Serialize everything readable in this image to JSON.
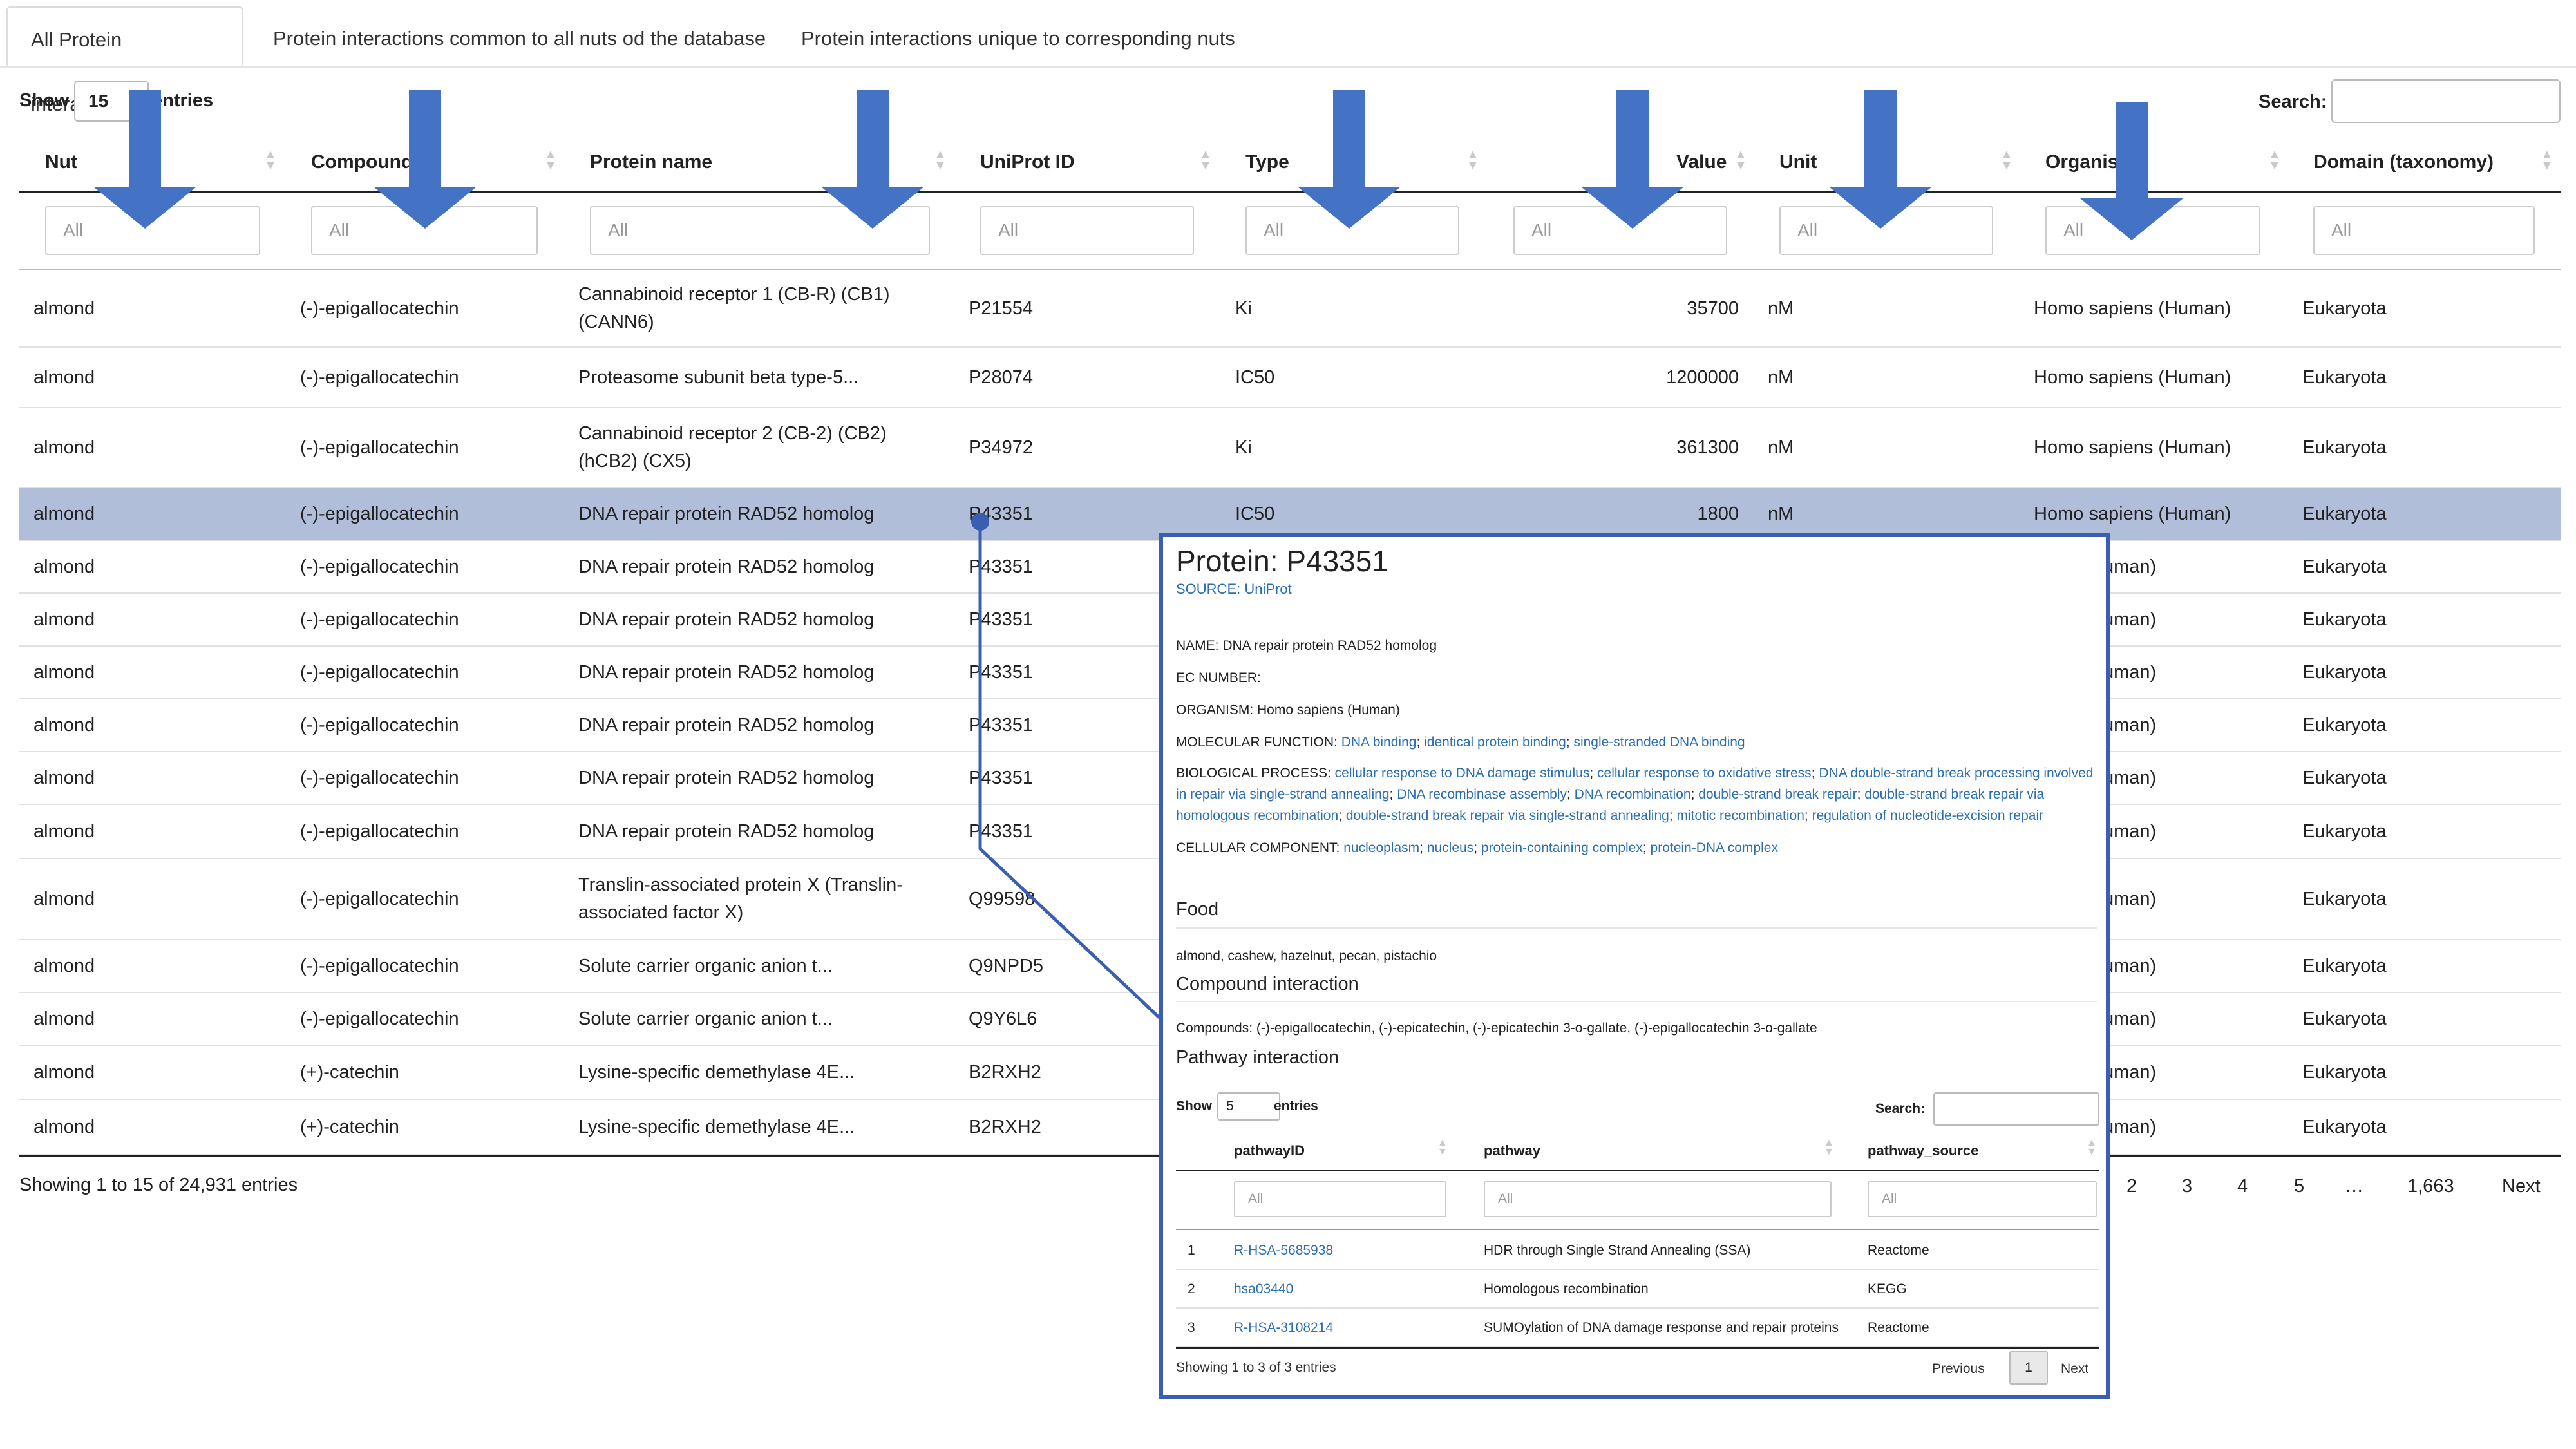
{
  "tabs": [
    {
      "label": "All Protein interactions",
      "active": true
    },
    {
      "label": "Protein interactions common to all nuts od the database",
      "active": false
    },
    {
      "label": "Protein interactions unique to corresponding nuts",
      "active": false
    }
  ],
  "length_control": {
    "show": "Show",
    "value": "15",
    "entries": "entries"
  },
  "search": {
    "label": "Search:",
    "value": ""
  },
  "columns": [
    "Nut",
    "Compound",
    "Protein name",
    "UniProt ID",
    "Type",
    "Value",
    "Unit",
    "Organism",
    "Domain (taxonomy)"
  ],
  "filter_placeholder": "All",
  "rows": [
    {
      "nut": "almond",
      "compound": "(-)-epigallocatechin",
      "protein": "Cannabinoid receptor 1 (CB-R) (CB1) (CANN6)",
      "uniprot": "P21554",
      "type": "Ki",
      "value": "35700",
      "unit": "nM",
      "organism": "Homo sapiens (Human)",
      "domain": "Eukaryota"
    },
    {
      "nut": "almond",
      "compound": "(-)-epigallocatechin",
      "protein": "Proteasome subunit beta type-5...",
      "uniprot": "P28074",
      "type": "IC50",
      "value": "1200000",
      "unit": "nM",
      "organism": "Homo sapiens (Human)",
      "domain": "Eukaryota"
    },
    {
      "nut": "almond",
      "compound": "(-)-epigallocatechin",
      "protein": "Cannabinoid receptor 2 (CB-2) (CB2) (hCB2) (CX5)",
      "uniprot": "P34972",
      "type": "Ki",
      "value": "361300",
      "unit": "nM",
      "organism": "Homo sapiens (Human)",
      "domain": "Eukaryota"
    },
    {
      "nut": "almond",
      "compound": "(-)-epigallocatechin",
      "protein": "DNA repair protein RAD52 homolog",
      "uniprot": "P43351",
      "type": "IC50",
      "value": "1800",
      "unit": "nM",
      "organism": "Homo sapiens (Human)",
      "domain": "Eukaryota"
    },
    {
      "nut": "almond",
      "compound": "(-)-epigallocatechin",
      "protein": "DNA repair protein RAD52 homolog",
      "uniprot": "P43351",
      "type": "",
      "value": "",
      "unit": "",
      "organism": "piens (Human)",
      "domain": "Eukaryota"
    },
    {
      "nut": "almond",
      "compound": "(-)-epigallocatechin",
      "protein": "DNA repair protein RAD52 homolog",
      "uniprot": "P43351",
      "type": "",
      "value": "",
      "unit": "",
      "organism": "piens (Human)",
      "domain": "Eukaryota"
    },
    {
      "nut": "almond",
      "compound": "(-)-epigallocatechin",
      "protein": "DNA repair protein RAD52 homolog",
      "uniprot": "P43351",
      "type": "",
      "value": "",
      "unit": "",
      "organism": "piens (Human)",
      "domain": "Eukaryota"
    },
    {
      "nut": "almond",
      "compound": "(-)-epigallocatechin",
      "protein": "DNA repair protein RAD52 homolog",
      "uniprot": "P43351",
      "type": "",
      "value": "",
      "unit": "",
      "organism": "piens (Human)",
      "domain": "Eukaryota"
    },
    {
      "nut": "almond",
      "compound": "(-)-epigallocatechin",
      "protein": "DNA repair protein RAD52 homolog",
      "uniprot": "P43351",
      "type": "",
      "value": "",
      "unit": "",
      "organism": "piens (Human)",
      "domain": "Eukaryota"
    },
    {
      "nut": "almond",
      "compound": "(-)-epigallocatechin",
      "protein": "DNA repair protein RAD52 homolog",
      "uniprot": "P43351",
      "type": "",
      "value": "",
      "unit": "",
      "organism": "piens (Human)",
      "domain": "Eukaryota"
    },
    {
      "nut": "almond",
      "compound": "(-)-epigallocatechin",
      "protein": "Translin-associated protein X (Translin-associated factor X)",
      "uniprot": "Q99598",
      "type": "",
      "value": "",
      "unit": "",
      "organism": "piens (Human)",
      "domain": "Eukaryota"
    },
    {
      "nut": "almond",
      "compound": "(-)-epigallocatechin",
      "protein": "Solute carrier organic anion t...",
      "uniprot": "Q9NPD5",
      "type": "",
      "value": "",
      "unit": "",
      "organism": "piens (Human)",
      "domain": "Eukaryota"
    },
    {
      "nut": "almond",
      "compound": "(-)-epigallocatechin",
      "protein": "Solute carrier organic anion t...",
      "uniprot": "Q9Y6L6",
      "type": "",
      "value": "",
      "unit": "",
      "organism": "piens (Human)",
      "domain": "Eukaryota"
    },
    {
      "nut": "almond",
      "compound": "(+)-catechin",
      "protein": "Lysine-specific demethylase 4E...",
      "uniprot": "B2RXH2",
      "type": "",
      "value": "",
      "unit": "",
      "organism": "piens (Human)",
      "domain": "Eukaryota"
    },
    {
      "nut": "almond",
      "compound": "(+)-catechin",
      "protein": "Lysine-specific demethylase 4E...",
      "uniprot": "B2RXH2",
      "type": "",
      "value": "",
      "unit": "",
      "organism": "piens (Human)",
      "domain": "Eukaryota"
    }
  ],
  "selected_row_index": 3,
  "info": "Showing 1 to 15 of 24,931 entries",
  "pagination": [
    "2",
    "3",
    "4",
    "5",
    "…",
    "1,663",
    "Next"
  ],
  "popup": {
    "title": "Protein: P43351",
    "source": "SOURCE: UniProt",
    "name_line": "NAME: DNA repair protein RAD52 homolog",
    "ec_line": "EC NUMBER:",
    "organism_line": "ORGANISM: Homo sapiens (Human)",
    "mf_label": "MOLECULAR FUNCTION: ",
    "mf_terms": [
      "DNA binding",
      "identical protein binding",
      "single-stranded DNA binding"
    ],
    "bp_label": "BIOLOGICAL PROCESS: ",
    "bp_terms": [
      "cellular response to DNA damage stimulus",
      "cellular response to oxidative stress",
      "DNA double-strand break processing involved in repair via single-strand annealing",
      "DNA recombinase assembly",
      "DNA recombination",
      "double-strand break repair",
      "double-strand break repair via homologous recombination",
      "double-strand break repair via single-strand annealing",
      "mitotic recombination",
      "regulation of nucleotide-excision repair"
    ],
    "cc_label": "CELLULAR COMPONENT: ",
    "cc_terms": [
      "nucleoplasm",
      "nucleus",
      "protein-containing complex",
      "protein-DNA complex"
    ],
    "food_heading": "Food",
    "food_text": "almond, cashew, hazelnut, pecan, pistachio",
    "compound_heading": "Compound interaction",
    "compound_text": "Compounds: (-)-epigallocatechin, (-)-epicatechin, (-)-epicatechin 3-o-gallate, (-)-epigallocatechin 3-o-gallate",
    "pathway_heading": "Pathway interaction",
    "inner_show": "Show",
    "inner_len": "5",
    "inner_entries": "entries",
    "inner_search": "Search:",
    "inner_columns": [
      "pathwayID",
      "pathway",
      "pathway_source"
    ],
    "inner_filter": "All",
    "inner_rows": [
      {
        "n": "1",
        "id": "R-HSA-5685938",
        "pathway": "HDR through Single Strand Annealing (SSA)",
        "source": "Reactome"
      },
      {
        "n": "2",
        "id": "hsa03440",
        "pathway": "Homologous recombination",
        "source": "KEGG"
      },
      {
        "n": "3",
        "id": "R-HSA-3108214",
        "pathway": "SUMOylation of DNA damage response and repair proteins",
        "source": "Reactome"
      }
    ],
    "inner_info": "Showing 1 to 3 of 3 entries",
    "inner_prev": "Previous",
    "inner_page": "1",
    "inner_next": "Next"
  },
  "colors": {
    "arrow": "#4472c4",
    "selected_row": "#b0bed9",
    "link": "#2b6fb3",
    "popup_border": "#3b5fb0"
  }
}
